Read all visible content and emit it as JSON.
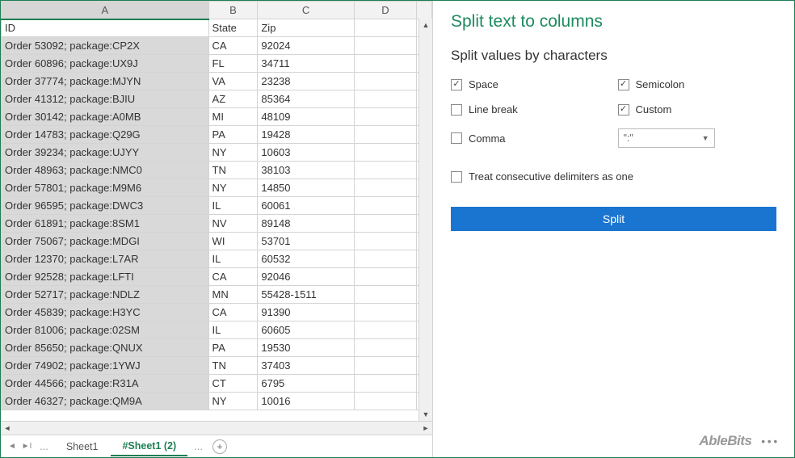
{
  "columns": [
    "A",
    "B",
    "C",
    "D"
  ],
  "headers": {
    "id": "ID",
    "state": "State",
    "zip": "Zip"
  },
  "rows": [
    {
      "id": "Order 53092; package:CP2X",
      "state": "CA",
      "zip": "92024"
    },
    {
      "id": "Order 60896; package:UX9J",
      "state": "FL",
      "zip": "34711"
    },
    {
      "id": "Order 37774; package:MJYN",
      "state": "VA",
      "zip": "23238"
    },
    {
      "id": "Order 41312; package:BJIU",
      "state": "AZ",
      "zip": "85364"
    },
    {
      "id": "Order 30142; package:A0MB",
      "state": "MI",
      "zip": "48109"
    },
    {
      "id": "Order 14783; package:Q29G",
      "state": "PA",
      "zip": "19428"
    },
    {
      "id": "Order 39234; package:UJYY",
      "state": "NY",
      "zip": "10603"
    },
    {
      "id": "Order 48963; package:NMC0",
      "state": "TN",
      "zip": "38103"
    },
    {
      "id": "Order 57801; package:M9M6",
      "state": "NY",
      "zip": "14850"
    },
    {
      "id": "Order 96595; package:DWC3",
      "state": "IL",
      "zip": "60061"
    },
    {
      "id": "Order 61891; package:8SM1",
      "state": "NV",
      "zip": "89148"
    },
    {
      "id": "Order 75067; package:MDGI",
      "state": "WI",
      "zip": "53701"
    },
    {
      "id": "Order 12370; package:L7AR",
      "state": "IL",
      "zip": "60532"
    },
    {
      "id": "Order 92528; package:LFTI",
      "state": "CA",
      "zip": "92046"
    },
    {
      "id": "Order 52717; package:NDLZ",
      "state": "MN",
      "zip": "55428-1511"
    },
    {
      "id": "Order 45839; package:H3YC",
      "state": "CA",
      "zip": "91390"
    },
    {
      "id": "Order 81006; package:02SM",
      "state": "IL",
      "zip": "60605"
    },
    {
      "id": "Order 85650; package:QNUX",
      "state": "PA",
      "zip": "19530"
    },
    {
      "id": "Order 74902; package:1YWJ",
      "state": "TN",
      "zip": "37403"
    },
    {
      "id": "Order 44566; package:R31A",
      "state": "CT",
      "zip": "6795"
    },
    {
      "id": "Order 46327; package:QM9A",
      "state": "NY",
      "zip": "10016"
    }
  ],
  "tabs": {
    "sheet1": "Sheet1",
    "active": "#Sheet1 (2)",
    "dots": "..."
  },
  "panel": {
    "title": "Split text to columns",
    "subtitle": "Split values by characters",
    "opts": {
      "space": "Space",
      "semicolon": "Semicolon",
      "linebreak": "Line break",
      "custom": "Custom",
      "comma": "Comma",
      "custom_val": "\":\""
    },
    "treat": "Treat consecutive delimiters as one",
    "split_btn": "Split"
  },
  "brand": "AbleBits"
}
